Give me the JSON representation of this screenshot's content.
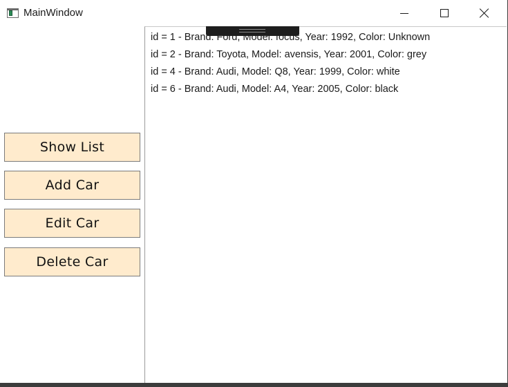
{
  "window": {
    "title": "MainWindow",
    "icon": "window-app-icon",
    "controls": {
      "minimize_icon": "minimize-icon",
      "maximize_icon": "maximize-icon",
      "close_icon": "close-icon"
    }
  },
  "sidebar": {
    "buttons": [
      {
        "label": "Show List"
      },
      {
        "label": "Add Car"
      },
      {
        "label": "Edit Car"
      },
      {
        "label": "Delete Car"
      }
    ]
  },
  "car_list": {
    "items": [
      "id = 1 - Brand: Ford, Model: focus, Year: 1992, Color: Unknown",
      "id = 2 - Brand: Toyota, Model: avensis, Year: 2001, Color: grey",
      "id = 4 - Brand: Audi, Model: Q8, Year: 1999, Color: white",
      "id = 6 - Brand: Audi, Model: A4, Year: 2005, Color: black"
    ]
  },
  "colors": {
    "button_background": "#ffebcd",
    "button_border": "#7a7a7a",
    "debug_toolbar": "#1e1e1e"
  }
}
